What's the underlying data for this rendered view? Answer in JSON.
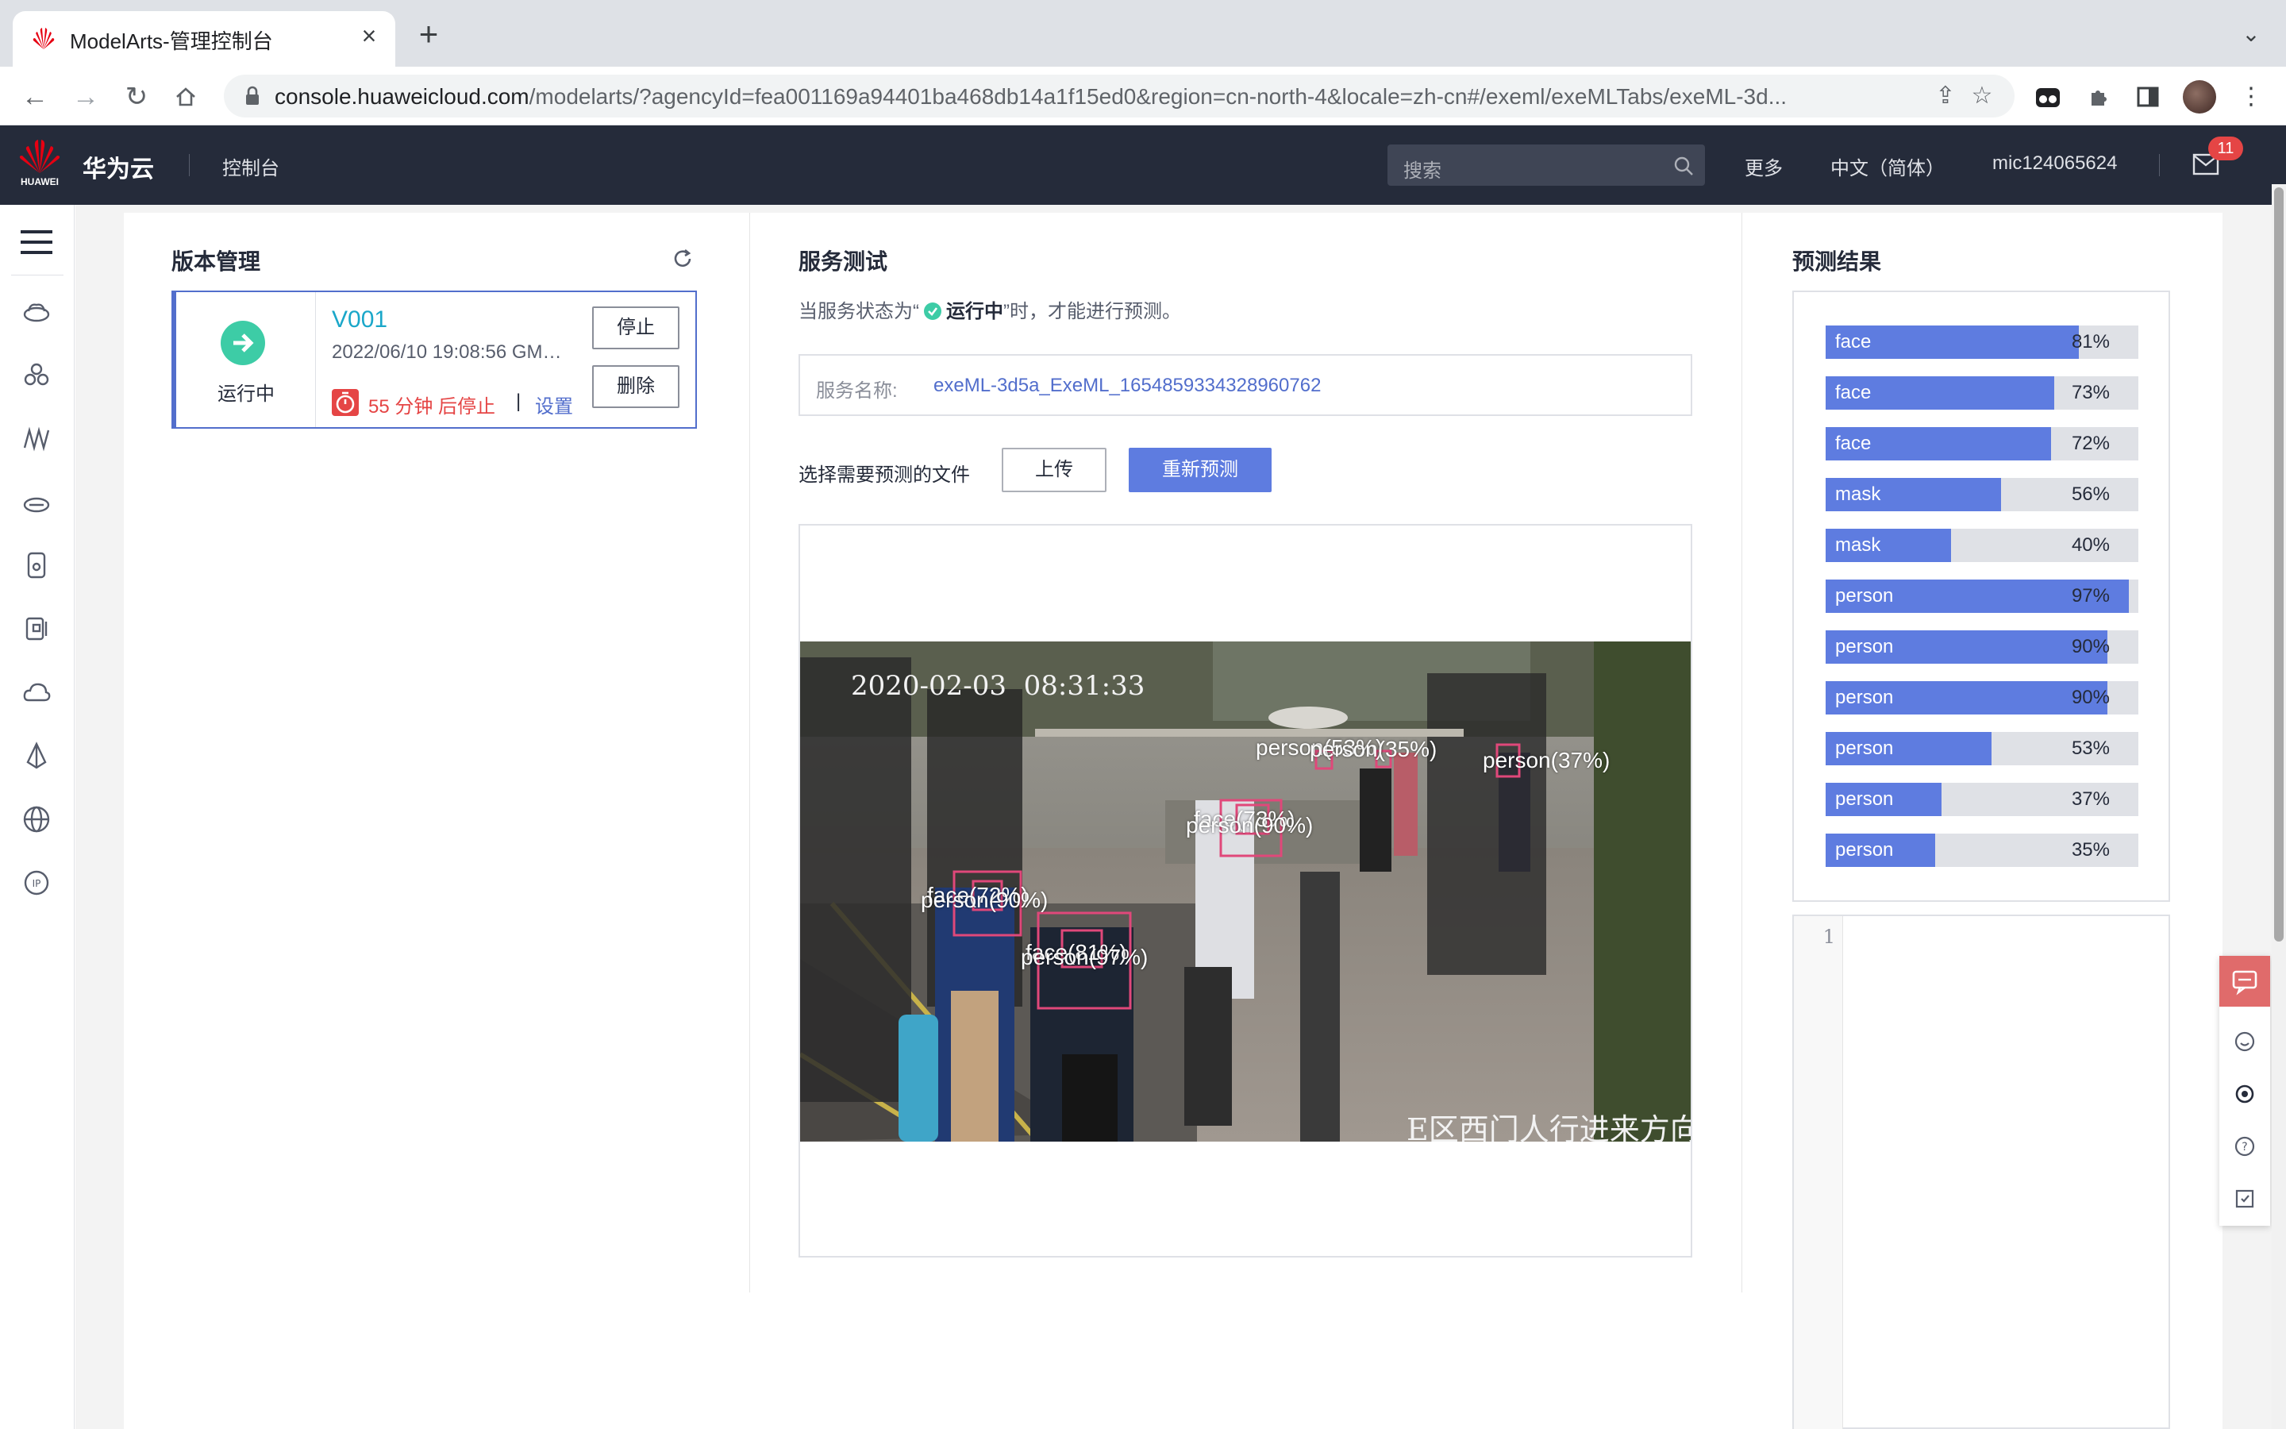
{
  "browser": {
    "tab_title": "ModelArts-管理控制台",
    "url_host": "console.huaweicloud.com",
    "url_path": "/modelarts/?agencyId=fea001169a94401ba468db14a1f15ed0&region=cn-north-4&locale=zh-cn#/exeml/exeMLTabs/exeML-3d..."
  },
  "header": {
    "logo_text": "HUAWEI",
    "brand": "华为云",
    "console": "控制台",
    "search_placeholder": "搜索",
    "more": "更多",
    "language": "中文（简体）",
    "username": "mic124065624",
    "mail_badge": "11"
  },
  "version_panel": {
    "title": "版本管理",
    "status": "运行中",
    "version": "V001",
    "date": "2022/06/10 19:08:56 GMT+08:00",
    "stop_countdown": "55 分钟 后停止",
    "separator": "|",
    "settings": "设置",
    "stop_button": "停止",
    "delete_button": "删除"
  },
  "service_test": {
    "title": "服务测试",
    "hint_prefix": "当服务状态为“",
    "hint_status": "运行中",
    "hint_suffix": "”时，才能进行预测。",
    "service_name_label": "服务名称:",
    "service_name_value": "exeML-3d5a_ExeML_1654859334328960762",
    "choose_file_label": "选择需要预测的文件",
    "upload_button": "上传",
    "repredict_button": "重新预测",
    "image": {
      "timestamp_overlay": "2020-02-03  08:31:33",
      "location_overlay": "E区西门人行进来方向",
      "detections": [
        {
          "text": "person(53%)"
        },
        {
          "text": "person(35%)"
        },
        {
          "text": "person(37%)"
        },
        {
          "text": "face(73%)"
        },
        {
          "text": "person(90%)"
        },
        {
          "text": "face(72%)"
        },
        {
          "text": "person(90%)"
        },
        {
          "text": "face(81%)"
        },
        {
          "text": "person(97%)"
        }
      ]
    }
  },
  "predictions": {
    "title": "预测结果",
    "items": [
      {
        "label": "face",
        "pct": "81%",
        "value": 81
      },
      {
        "label": "face",
        "pct": "73%",
        "value": 73
      },
      {
        "label": "face",
        "pct": "72%",
        "value": 72
      },
      {
        "label": "mask",
        "pct": "56%",
        "value": 56
      },
      {
        "label": "mask",
        "pct": "40%",
        "value": 40
      },
      {
        "label": "person",
        "pct": "97%",
        "value": 97
      },
      {
        "label": "person",
        "pct": "90%",
        "value": 90
      },
      {
        "label": "person",
        "pct": "90%",
        "value": 90
      },
      {
        "label": "person",
        "pct": "53%",
        "value": 53
      },
      {
        "label": "person",
        "pct": "37%",
        "value": 37
      },
      {
        "label": "person",
        "pct": "35%",
        "value": 35
      }
    ],
    "editor_line": "1"
  },
  "colors": {
    "header_bg": "#252b3a",
    "accent_blue": "#5e7ce0",
    "status_green": "#3dcca6",
    "warning_red": "#e54545",
    "link_blue": "#526ecc"
  }
}
